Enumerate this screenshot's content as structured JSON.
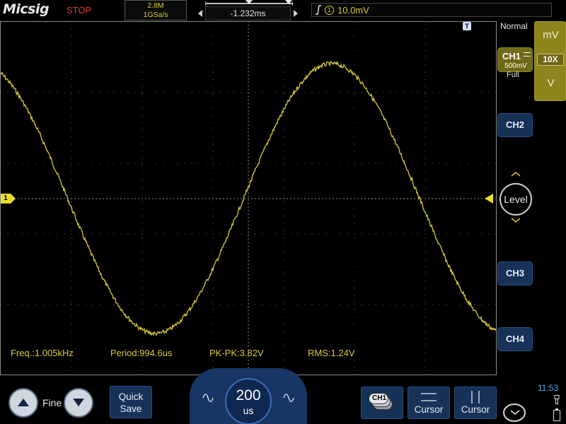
{
  "header": {
    "brand": "Micsig",
    "run_state": "STOP",
    "memory_depth": "2.8M",
    "sample_rate": "1GSa/s",
    "trigger_delay": "-1.232ms",
    "trigger_source": "1",
    "trigger_level": "10.0mV"
  },
  "plot": {
    "channel_marker": "1",
    "trigger_time_marker": "T",
    "waveform_color": "#d8cc3a",
    "frequency_hz": 1005,
    "time_per_div_us": 200,
    "volts_per_div_mv": 500,
    "peak_to_peak_v": 3.82
  },
  "measurements": {
    "freq": "Freq.:1.005kHz",
    "period": "Period:994.6us",
    "pkpk": "PK-PK:3.82V",
    "rms": "RMS:1.24V"
  },
  "right_panel": {
    "trigger_mode": "Normal",
    "ch1_name": "CH1",
    "ch1_scale": "500mV",
    "ch1_bandwidth": "Full",
    "unit_mv": "mV",
    "probe": "10X",
    "unit_v": "V",
    "ch2_label": "CH2",
    "ch3_label": "CH3",
    "ch4_label": "CH4",
    "level_label": "Level"
  },
  "bottom": {
    "fine_label": "Fine",
    "quick_save_line1": "Quick",
    "quick_save_line2": "Save",
    "timebase_value": "200",
    "timebase_unit": "us",
    "ch_ref_label": "CH1",
    "cursor_h_label": "Cursor",
    "cursor_v_label": "Cursor",
    "clock": "11:53"
  },
  "colors": {
    "ch1": "#e9df2a",
    "accent_blue": "#173157",
    "stop": "#e23c3c",
    "clock": "#58a9e8"
  }
}
